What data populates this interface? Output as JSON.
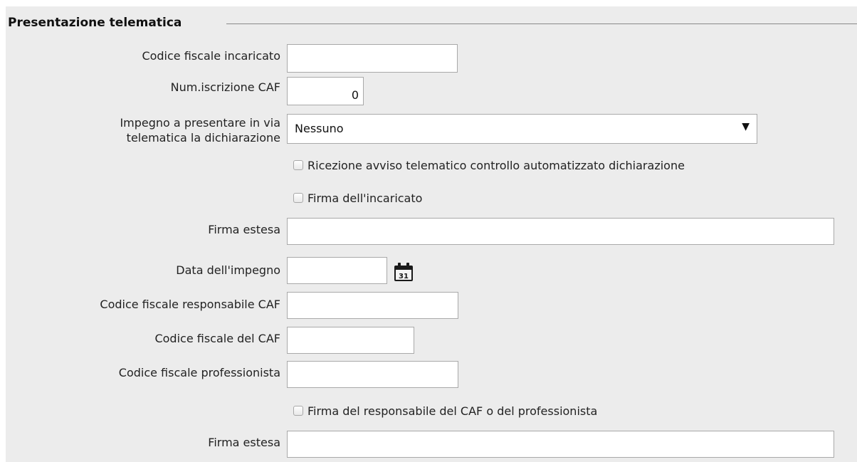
{
  "section": {
    "title": "Presentazione telematica"
  },
  "fields": {
    "codice_fiscale_incaricato": {
      "label": "Codice fiscale incaricato",
      "value": ""
    },
    "num_iscrizione_caf": {
      "label": "Num.iscrizione CAF",
      "value": "0"
    },
    "impegno": {
      "label_line1": "Impegno a presentare in via",
      "label_line2": "telematica la dichiarazione",
      "selected": "Nessuno",
      "arrow_icon": "down-triangle-icon"
    },
    "ricezione_avviso": {
      "label": "Ricezione avviso telematico controllo automatizzato dichiarazione",
      "checked": false
    },
    "firma_incaricato": {
      "label": "Firma dell'incaricato",
      "checked": false
    },
    "firma_estesa_1": {
      "label": "Firma estesa",
      "value": ""
    },
    "data_impegno": {
      "label": "Data dell'impegno",
      "value": "",
      "calendar_icon": "calendar-icon",
      "calendar_day": "31"
    },
    "cf_responsabile_caf": {
      "label": "Codice fiscale responsabile CAF",
      "value": ""
    },
    "cf_caf": {
      "label": "Codice fiscale del CAF",
      "value": ""
    },
    "cf_professionista": {
      "label": "Codice fiscale professionista",
      "value": ""
    },
    "firma_responsabile": {
      "label": "Firma del responsabile del CAF o del professionista",
      "checked": false
    },
    "firma_estesa_2": {
      "label": "Firma estesa",
      "value": ""
    }
  },
  "colors": {
    "panel_background": "#ececec",
    "input_border": "#a9a9a9",
    "divider": "#8a8a8a"
  }
}
